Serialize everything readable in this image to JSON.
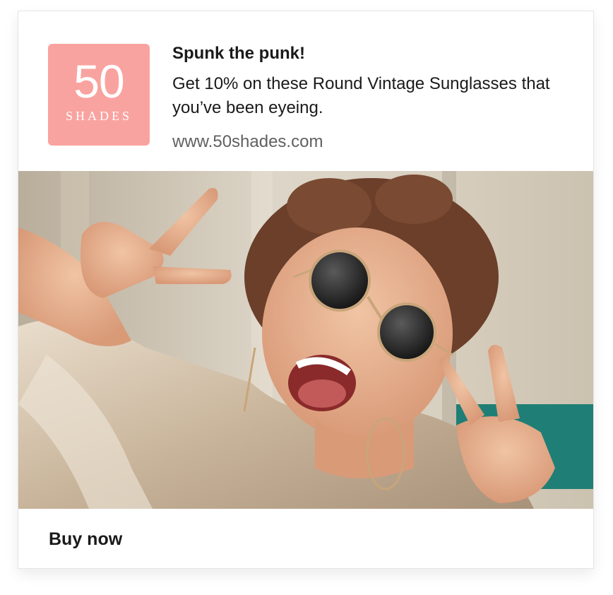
{
  "ad": {
    "logo": {
      "number": "50",
      "word": "SHADES",
      "color": "#f9a3a0"
    },
    "headline": "Spunk the punk!",
    "body": "Get 10% on these Round Vintage Sunglasses that you’ve been eyeing.",
    "url": "www.50shades.com",
    "image": {
      "icon": "photo-woman-sunglasses-peace-sign"
    },
    "cta": "Buy now"
  }
}
